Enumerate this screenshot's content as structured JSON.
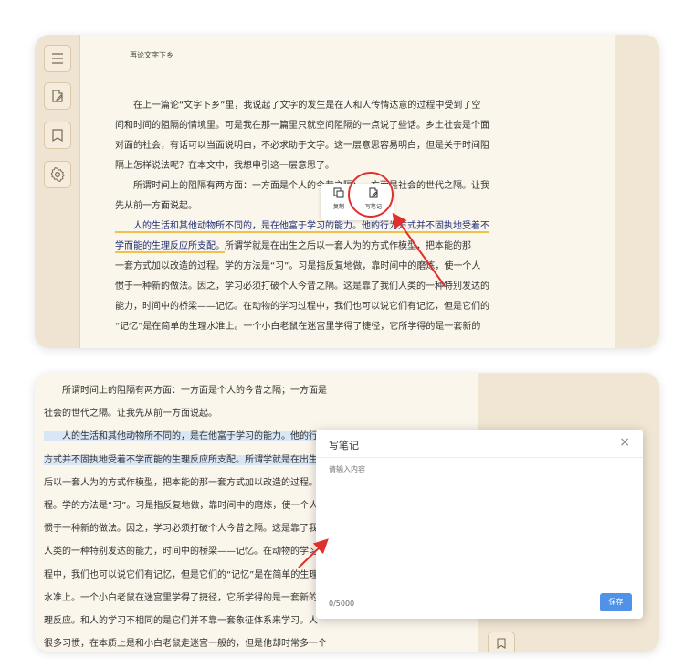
{
  "colors": {
    "annotation_red": "#e0302e",
    "highlight_underline": "#f0c14b",
    "selection_blue": "#d8e6f6",
    "save_button": "#4f92e8",
    "paper": "#fbf6ec"
  },
  "reader": {
    "sidebar_icons": [
      "menu-icon",
      "note-edit-icon",
      "bookmark-icon",
      "settings-gear-icon"
    ],
    "running_head": "再论文字下乡",
    "lines": [
      "　　在上一篇论“文字下乡”里，我说起了文字的发生是在人和人传情达意的过程中受到了空",
      "间和时间的阻隔的情境里。可是我在那一篇里只就空间阻隔的一点说了些话。乡土社会是个面",
      "对面的社会，有话可以当面说明白，不必求助于文字。这一层意思容易明白，但是关于时间阻",
      "隔上怎样说法呢？在本文中，我想申引这一层意思了。",
      "　　所谓时间上的阻隔有两方面：一方面是个人的今昔之隔；一方面是社会的世代之隔。让我",
      "先从前一方面说起。"
    ],
    "hl_line1": "　　人的生活和其他动物所不同的，是在他富于学习的能力。他的行为方式并不固执地受着不",
    "hl_line2_a": "学而能的生理反应所支配。",
    "hl_line2_b": "所谓学就是在出生之后以一套人为的方式作模型，把本能的那",
    "lines_after": [
      "一套方式加以改造的过程。学的方法是“习”。习是指反复地做，靠时间中的磨炼，使一个人",
      "惯于一种新的做法。因之，学习必须打破个人今昔之隔。这是靠了我们人类的一种特别发达的",
      "能力，时间中的桥梁——记忆。在动物的学习过程中，我们也可以说它们有记忆，但是它们的",
      "“记忆”是在简单的生理水准上。一个小白老鼠在迷宫里学得了捷径，它所学得的是一套新的"
    ],
    "popup": {
      "copy_label": "复制",
      "note_label": "写笔记"
    }
  },
  "editor": {
    "lines": [
      {
        "text": "　　所谓时间上的阻隔有两方面：一方面是个人的今昔之隔；一方面是",
        "selected": false
      },
      {
        "text": "社会的世代之隔。让我先从前一方面说起。",
        "selected": false
      },
      {
        "text": "　　人的生活和其他动物所不同的，是在他富于学习的能力。他的行为",
        "selected": true
      },
      {
        "text": "方式并不固执地受着不学而能的生理反应所支配。所谓学就是在出生之",
        "selected": true
      },
      {
        "text": "后以一套人为的方式作模型，把本能的那一套方式加以改造的过程。学的方法",
        "selected": false
      },
      {
        "text": "程。学的方法是“习”。习是指反复地做，靠时间中的磨炼，使一个人",
        "selected": false
      },
      {
        "text": "惯于一种新的做法。因之，学习必须打破个人今昔之隔。这是靠了我们",
        "selected": false
      },
      {
        "text": "人类的一种特别发达的能力，时间中的桥梁——记忆。在动物的学习过",
        "selected": false
      },
      {
        "text": "程中，我们也可以说它们有记忆，但是它们的“记忆”是在简单的生理",
        "selected": false
      },
      {
        "text": "水准上。一个小白老鼠在迷宫里学得了捷径，它所学得的是一套新的生",
        "selected": false
      },
      {
        "text": "理反应。和人的学习不相同的是它们并不靠一套象征体系来学习。人",
        "selected": false
      },
      {
        "text": "很多习惯，在本质上是和小白老鼠走迷宫一般的，但是他却时常多一个",
        "selected": false
      }
    ],
    "side_icon": "bookmark-icon",
    "modal": {
      "title": "写笔记",
      "close_symbol": "×",
      "placeholder": "请输入内容",
      "counter": "0/5000",
      "save_label": "保存"
    }
  }
}
